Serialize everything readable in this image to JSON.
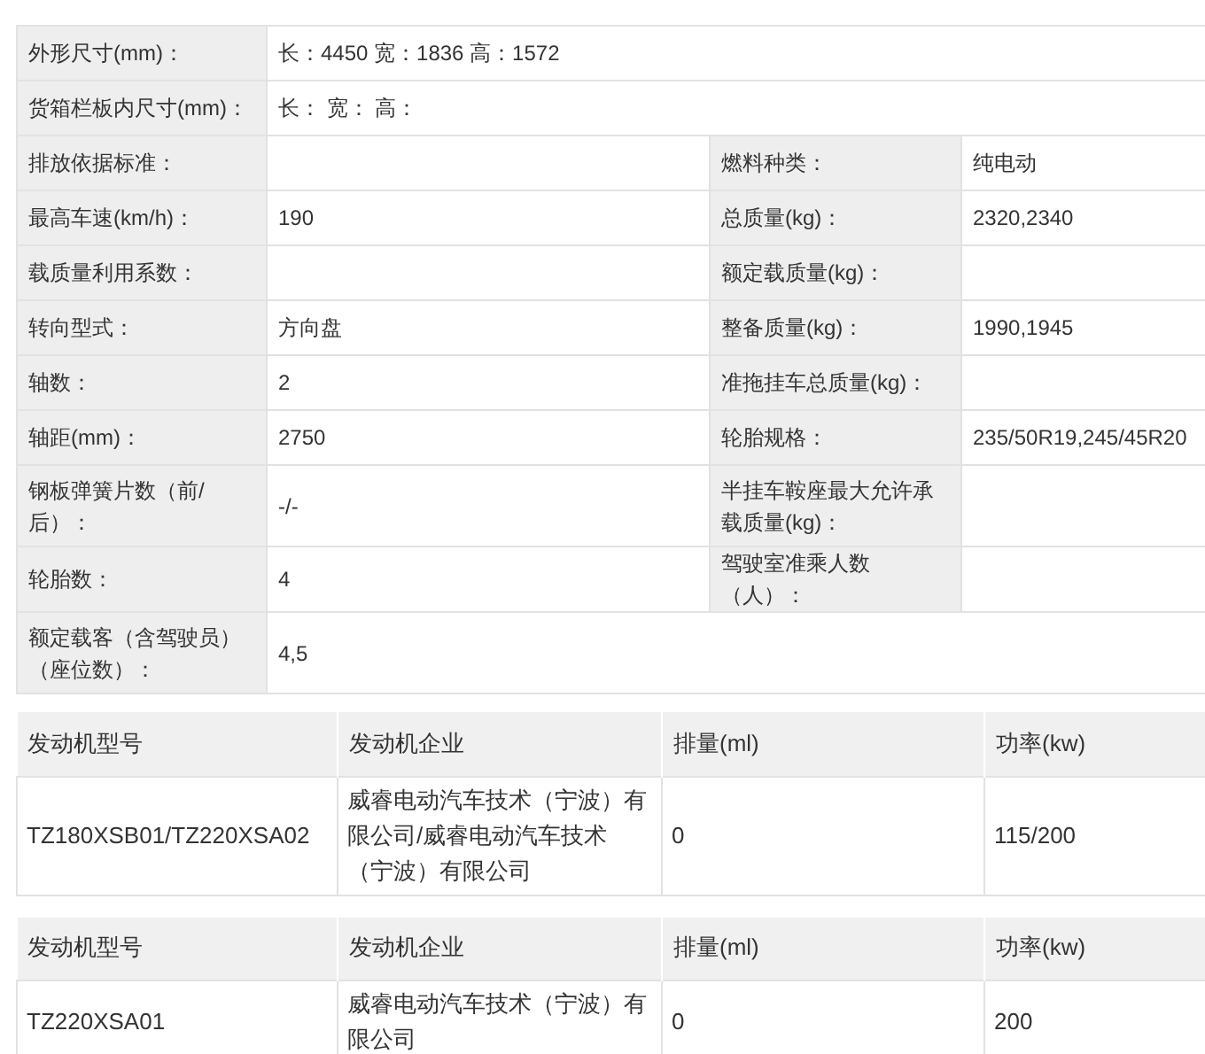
{
  "spec_rows": [
    [
      {
        "label": "外形尺寸(mm)：",
        "value": "长：4450 宽：1836 高：1572"
      }
    ],
    [
      {
        "label": "货箱栏板内尺寸(mm)：",
        "value": "长：  宽：  高："
      }
    ],
    [
      {
        "label": "排放依据标准："
      },
      {
        "label": "燃料种类：",
        "value": "纯电动"
      }
    ],
    [
      {
        "label": "最高车速(km/h)：",
        "value": "190"
      },
      {
        "label": "总质量(kg)：",
        "value": "2320,2340"
      }
    ],
    [
      {
        "label": "载质量利用系数："
      },
      {
        "label": "额定载质量(kg)："
      }
    ],
    [
      {
        "label": "转向型式：",
        "value": "方向盘"
      },
      {
        "label": "整备质量(kg)：",
        "value": "1990,1945"
      }
    ],
    [
      {
        "label": "轴数：",
        "value": "2"
      },
      {
        "label": "准拖挂车总质量(kg)："
      }
    ],
    [
      {
        "label": "轴距(mm)：",
        "value": "2750"
      },
      {
        "label": "轮胎规格：",
        "value": "235/50R19,245/45R20"
      }
    ],
    [
      {
        "label": "钢板弹簧片数（前/后）：",
        "value": "-/-"
      },
      {
        "label": "半挂车鞍座最大允许承载质量(kg)："
      }
    ],
    [
      {
        "label": "轮胎数：",
        "value": "4"
      },
      {
        "label": "驾驶室准乘人数（人）："
      }
    ],
    [
      {
        "label": "额定载客（含驾驶员）（座位数）：",
        "value": "4,5"
      }
    ]
  ],
  "engine_tables": [
    {
      "columns": [
        "发动机型号",
        "发动机企业",
        "排量(ml)",
        "功率(kw)"
      ],
      "rows": [
        [
          "TZ180XSB01/TZ220XSA02",
          "威睿电动汽车技术（宁波）有限公司/威睿电动汽车技术（宁波）有限公司",
          "0",
          "115/200"
        ]
      ]
    },
    {
      "columns": [
        "发动机型号",
        "发动机企业",
        "排量(ml)",
        "功率(kw)"
      ],
      "rows": [
        [
          "TZ220XSA01",
          "威睿电动汽车技术（宁波）有限公司",
          "0",
          "200"
        ]
      ]
    }
  ]
}
